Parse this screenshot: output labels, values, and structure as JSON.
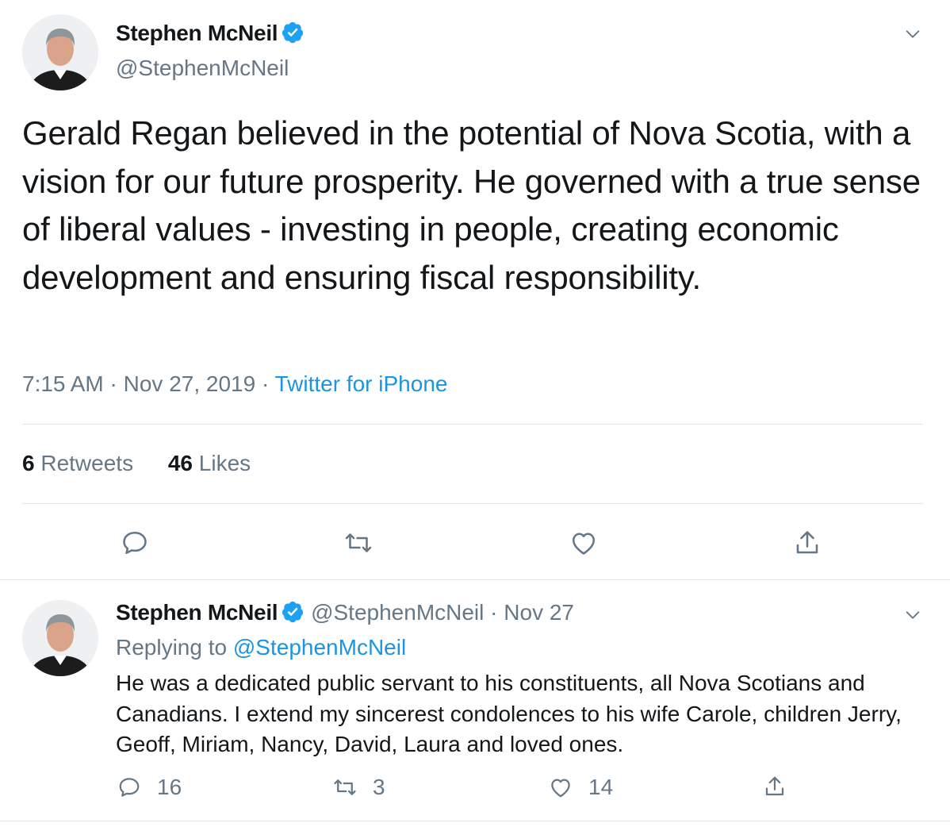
{
  "main_tweet": {
    "display_name": "Stephen McNeil",
    "handle": "@StephenMcNeil",
    "text": "Gerald Regan believed in the potential of Nova Scotia, with a vision for our future prosperity. He governed with a true sense of liberal values - investing in people, creating economic development and ensuring fiscal responsibility.",
    "time": "7:15 AM",
    "separator": "·",
    "date": "Nov 27, 2019",
    "source": "Twitter for iPhone",
    "retweets_count": "6",
    "retweets_label": "Retweets",
    "likes_count": "46",
    "likes_label": "Likes"
  },
  "reply_tweet": {
    "display_name": "Stephen McNeil",
    "handle": "@StephenMcNeil",
    "separator": "·",
    "date": "Nov 27",
    "replying_prefix": "Replying to",
    "replying_handle": "@StephenMcNeil",
    "text": "He was a dedicated public servant to his constituents, all Nova Scotians and Canadians. I extend my sincerest condolences to his wife Carole, children Jerry, Geoff, Miriam, Nancy, David, Laura and loved ones.",
    "reply_count": "16",
    "retweet_count": "3",
    "like_count": "14"
  },
  "icons": {
    "verified": "verified-badge-icon",
    "caret": "chevron-down-icon",
    "reply": "reply-icon",
    "retweet": "retweet-icon",
    "like": "heart-icon",
    "share": "share-icon"
  },
  "colors": {
    "text_primary": "#14171a",
    "text_secondary": "#657786",
    "link": "#1b95e0",
    "verified": "#1da1f2",
    "divider": "#e1e8ed"
  }
}
